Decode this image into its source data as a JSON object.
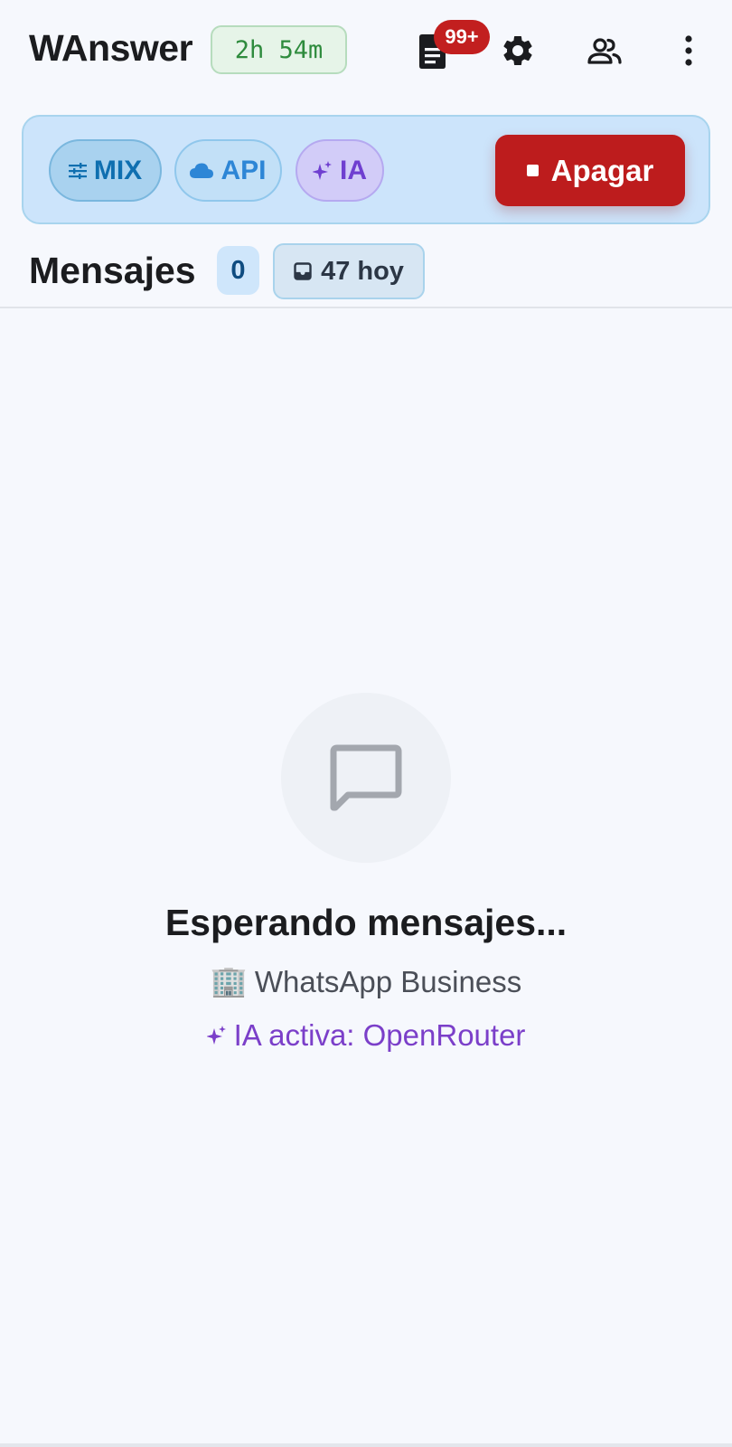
{
  "header": {
    "app_title": "WAnswer",
    "uptime": "2h 54m",
    "logs_badge": "99+",
    "icons": [
      "logs-icon",
      "gear-icon",
      "users-icon",
      "more-vert-icon"
    ]
  },
  "modes": {
    "mix_label": "MIX",
    "api_label": "API",
    "ia_label": "IA",
    "power_label": "Apagar"
  },
  "messages": {
    "title": "Mensajes",
    "count": "0",
    "today_label": "47 hoy"
  },
  "empty_state": {
    "title": "Esperando mensajes...",
    "business_emoji": "🏢",
    "business_text": "WhatsApp Business",
    "ai_text": "IA activa: OpenRouter"
  },
  "colors": {
    "accent_blue": "#0f6fb0",
    "danger_red": "#bd1c1d",
    "ai_purple": "#7b3fc9",
    "success_green": "#2e8b3d",
    "background": "#f6f8fd"
  }
}
